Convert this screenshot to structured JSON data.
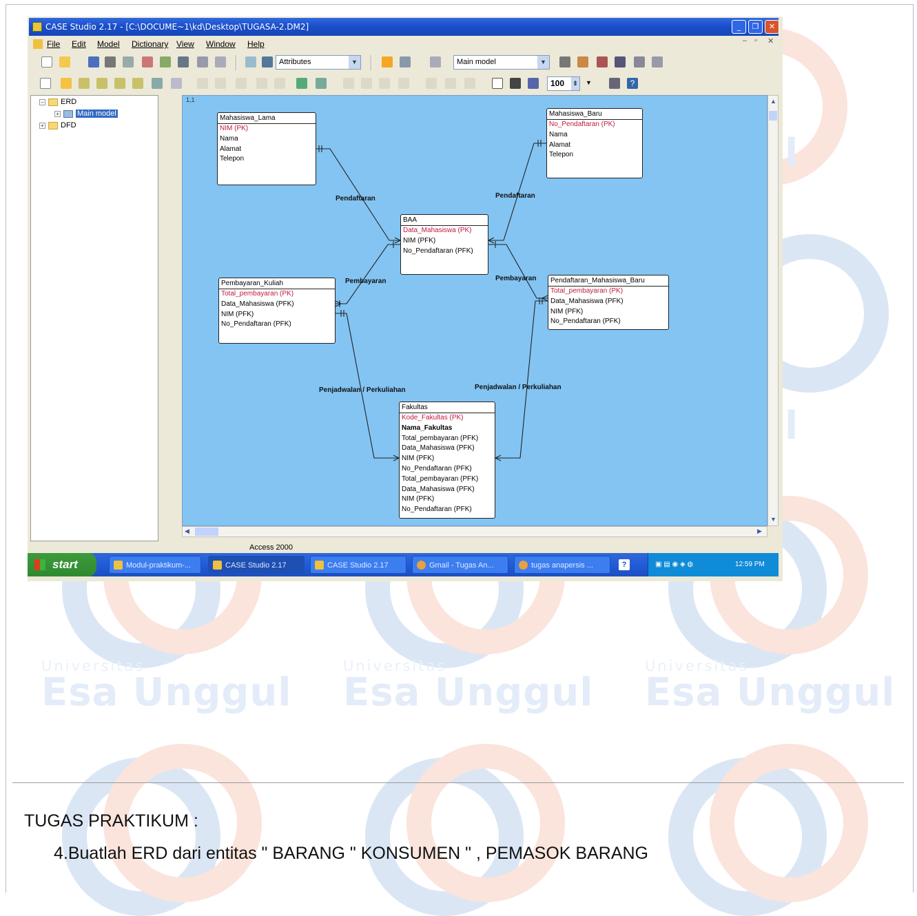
{
  "window": {
    "title": "CASE Studio 2.17 - [C:\\DOCUME~1\\kd\\Desktop\\TUGASA-2.DM2]"
  },
  "menu": [
    "File",
    "Edit",
    "Model",
    "Dictionary",
    "View",
    "Window",
    "Help"
  ],
  "toolbar": {
    "attributes_combo": "Attributes",
    "model_combo": "Main model",
    "zoom_value": "100"
  },
  "tree": {
    "root": "ERD",
    "child": "Main model",
    "second": "DFD"
  },
  "canvas": {
    "coord": "1,1"
  },
  "entities": [
    {
      "name": "Mahasiswa_Lama",
      "pk": [
        "NIM (PK)"
      ],
      "attrs": [
        "Nama",
        "Alamat",
        "Telepon"
      ]
    },
    {
      "name": "Mahasiswa_Baru",
      "pk": [
        "No_Pendaftaran (PK)"
      ],
      "attrs": [
        "Nama",
        "Alamat",
        "Telepon"
      ]
    },
    {
      "name": "BAA",
      "pk": [
        "Data_Mahasiswa (PK)"
      ],
      "attrs": [
        "NIM (PFK)",
        "No_Pendaftaran (PFK)"
      ]
    },
    {
      "name": "Pembayaran_Kuliah",
      "pk": [
        "Total_pembayaran (PK)"
      ],
      "attrs": [
        "Data_Mahasiswa (PFK)",
        "NIM (PFK)",
        "No_Pendaftaran (PFK)"
      ]
    },
    {
      "name": "Pendaftaran_Mahasiswa_Baru",
      "pk": [
        "Total_pembayaran (PK)"
      ],
      "attrs": [
        "Data_Mahasiswa (PFK)",
        "NIM (PFK)",
        "No_Pendaftaran (PFK)"
      ]
    },
    {
      "name": "Fakultas",
      "pk": [
        "Kode_Fakultas (PK)"
      ],
      "attrs": [
        "Nama_Fakultas",
        "Total_pembayaran (PFK)",
        "Data_Mahasiswa (PFK)",
        "NIM (PFK)",
        "No_Pendaftaran (PFK)",
        "Total_pembayaran (PFK)",
        "Data_Mahasiswa (PFK)",
        "NIM (PFK)",
        "No_Pendaftaran (PFK)"
      ]
    }
  ],
  "relations": {
    "r1": "Pendaftaran",
    "r2": "Pendaftaran",
    "r3": "Pembayaran",
    "r4": "Pembayaran",
    "r5": "Penjadwalan / Perkuliahan",
    "r6": "Penjadwalan / Perkuliahan"
  },
  "status": {
    "text": "Access 2000"
  },
  "taskbar": {
    "start": "start",
    "tasks": [
      "Modul-praktikum-...",
      "CASE Studio 2.17",
      "CASE Studio 2.17",
      "Gmail - Tugas An...",
      "tugas anapersis ..."
    ],
    "clock": "12:59 PM"
  },
  "watermark": {
    "small": "Universitas",
    "big": "Esa Unggul"
  },
  "document": {
    "heading": "TUGAS  PRAKTIKUM :",
    "item": "4.Buatlah ERD dari entitas \" BARANG \" KONSUMEN \" , PEMASOK  BARANG"
  },
  "colors": {
    "canvas": "#83c4f3",
    "pk_text": "#c0183c",
    "titlebar": "#1a4cc8"
  }
}
